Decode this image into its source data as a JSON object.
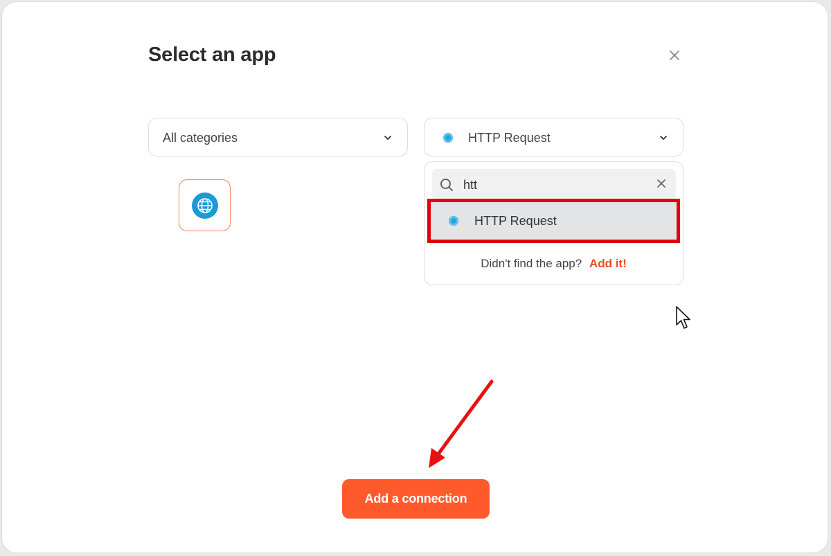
{
  "dialog": {
    "title": "Select an app",
    "close_icon": "close-icon"
  },
  "category_select": {
    "value": "All categories",
    "icon": "chevron-down-icon"
  },
  "app_select": {
    "value": "HTTP Request",
    "icon": "chevron-down-icon",
    "app_icon_color": "#29a3e0"
  },
  "app_tile": {
    "icon": "globe-icon",
    "border_color": "#f0805c"
  },
  "dropdown": {
    "search_value": "htt",
    "search_icon": "search-icon",
    "clear_icon": "close-icon",
    "options": [
      {
        "label": "HTTP Request",
        "icon": "globe-icon",
        "highlighted": true
      }
    ],
    "not_found_text": "Didn't find the app?",
    "add_link": "Add it!",
    "accent_color": "#f04a1d"
  },
  "footer": {
    "primary_button": "Add a connection",
    "button_color": "#ff5a2c"
  },
  "annotation": {
    "highlight_color": "#e00010"
  }
}
